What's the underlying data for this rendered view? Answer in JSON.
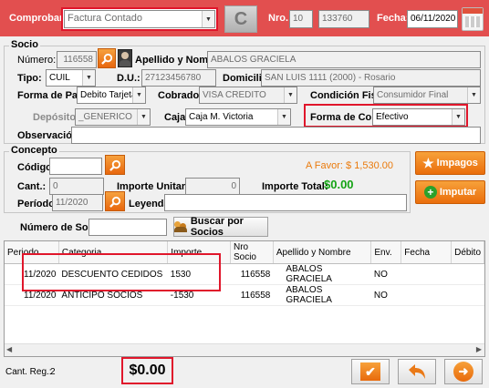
{
  "header": {
    "comprobante_label": "Comprobante:",
    "comprobante_value": "Factura Contado",
    "refresh_glyph": "C",
    "nro_label": "Nro.:",
    "nro_prefix": "10",
    "nro_value": "133760",
    "fecha_label": "Fecha:",
    "fecha_value": "06/11/2020"
  },
  "socio": {
    "section_title": "Socio",
    "numero_label": "Número:",
    "numero_value": "116558",
    "apellido_label": "Apellido y Nombre:",
    "apellido_value": "ABALOS GRACIELA",
    "tipo_label": "Tipo:",
    "tipo_value": "CUIL",
    "du_label": "D.U.:",
    "du_value": "27123456780",
    "domicilio_label": "Domicilio:",
    "domicilio_value": "SAN LUIS 1111 (2000) - Rosario",
    "forma_pago_label": "Forma de Pago:",
    "forma_pago_value": "Debito Tarjeta",
    "cobrador_label": "Cobrador:",
    "cobrador_value": "VISA CREDITO",
    "condicion_label": "Condición Fiscal:",
    "condicion_value": "Consumidor Final",
    "deposito_label": "Depósito:",
    "deposito_value": "_GENERICO",
    "caja_label": "Caja:",
    "caja_value": "Caja M. Victoria",
    "forma_cobro_label": "Forma de Cobro:",
    "forma_cobro_value": "Efectivo",
    "observacion_label": "Observación:",
    "observacion_value": ""
  },
  "concepto": {
    "section_title": "Concepto",
    "codigo_label": "Código:",
    "codigo_value": "",
    "a_favor_text": "A Favor: $ 1,530.00",
    "cant_label": "Cant.:",
    "cant_value": "0",
    "importe_unit_label": "Importe Unitario:",
    "importe_unit_value": "0",
    "importe_total_label": "Importe Total:",
    "importe_total_value": "$0.00",
    "periodo_label": "Período:",
    "periodo_value": "11/2020",
    "leyenda_label": "Leyenda:",
    "leyenda_value": ""
  },
  "side_buttons": {
    "impagos_label": "Impagos",
    "imputar_label": "Imputar"
  },
  "search": {
    "numero_socio_label": "Número de Socio:",
    "numero_socio_value": "",
    "buscar_label": "Buscar por Socios"
  },
  "grid": {
    "columns": [
      "Periodo",
      "Categoria",
      "Importe",
      "Nro Socio",
      "Apellido y Nombre",
      "Env.",
      "Fecha",
      "Débito"
    ],
    "rows": [
      {
        "periodo": "11/2020",
        "categoria": "DESCUENTO CEDIDOS",
        "importe": "1530",
        "nro_socio": "116558",
        "apellido": "ABALOS GRACIELA",
        "env": "NO",
        "fecha": "",
        "debito": ""
      },
      {
        "periodo": "11/2020",
        "categoria": "ANTICIPO SOCIOS",
        "importe": "-1530",
        "nro_socio": "116558",
        "apellido": "ABALOS GRACIELA",
        "env": "NO",
        "fecha": "",
        "debito": ""
      }
    ]
  },
  "footer": {
    "cant_reg_label": "Cant. Reg.:",
    "cant_reg_value": "2",
    "total_value": "$0.00"
  },
  "colors": {
    "topbar": "#e24f4f",
    "orange": "#ea6e0c",
    "green_total": "#14a314",
    "highlight_red": "#e0162b"
  }
}
